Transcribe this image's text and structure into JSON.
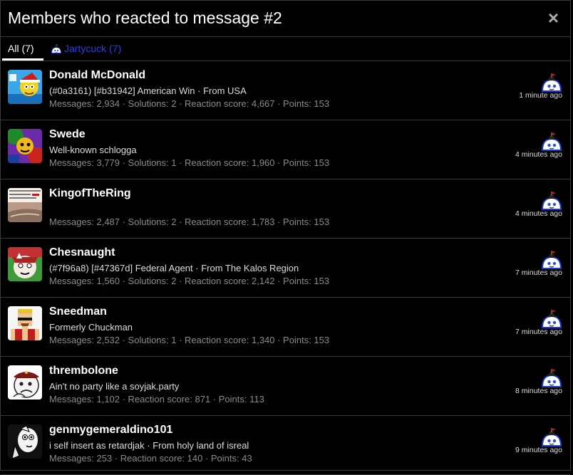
{
  "dialog": {
    "title": "Members who reacted to message #2",
    "close_glyph": "×"
  },
  "tabs": [
    {
      "label": "All (7)"
    },
    {
      "label": "Jartycuck (7)"
    }
  ],
  "members": [
    {
      "name": "Donald McDonald",
      "line1": "(#0a3161) [#b31942] American Win · From USA",
      "stats": "Messages: 2,934 · Solutions: 2 · Reaction score: 4,667 · Points: 153",
      "time": "1 minute ago"
    },
    {
      "name": "Swede",
      "line1": "Well-known schlogga",
      "stats": "Messages: 3,779 · Solutions: 1 · Reaction score: 1,960 · Points: 153",
      "time": "4 minutes ago"
    },
    {
      "name": "KingofTheRing",
      "line1": "",
      "stats": "Messages: 2,487 · Solutions: 2 · Reaction score: 1,783 · Points: 153",
      "time": "4 minutes ago"
    },
    {
      "name": "Chesnaught",
      "line1": "(#7f96a8) [#47367d] Federal Agent · From The Kalos Region",
      "stats": "Messages: 1,560 · Solutions: 2 · Reaction score: 2,142 · Points: 153",
      "time": "7 minutes ago"
    },
    {
      "name": "Sneedman",
      "line1": "Formerly Chuckman",
      "stats": "Messages: 2,532 · Solutions: 1 · Reaction score: 1,340 · Points: 153",
      "time": "7 minutes ago"
    },
    {
      "name": "thrembolone",
      "line1": "Ain't no party like a soyjak.party",
      "stats": "Messages: 1,102 · Reaction score: 871 · Points: 113",
      "time": "8 minutes ago"
    },
    {
      "name": "genmygemeraldino101",
      "line1": "i self insert as retardjak · From holy land of isreal",
      "stats": "Messages: 253 · Reaction score: 140 · Points: 43",
      "time": "9 minutes ago"
    }
  ],
  "avatar_lettering": {
    "kingoftheringbanner": "calls blount loss bridges"
  }
}
